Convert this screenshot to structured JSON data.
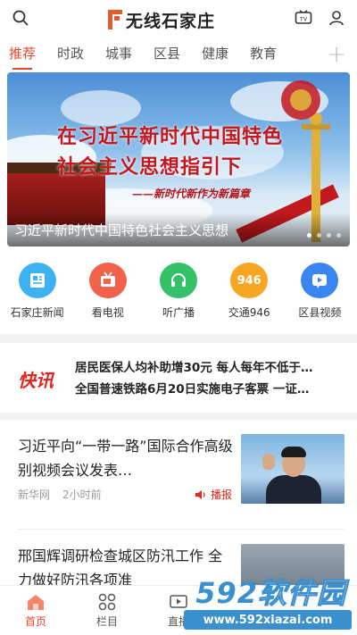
{
  "header": {
    "logo_text": "无线石家庄",
    "accent": "#e25c2c"
  },
  "tabs": {
    "items": [
      {
        "label": "推荐",
        "active": true
      },
      {
        "label": "时政"
      },
      {
        "label": "城事"
      },
      {
        "label": "区县"
      },
      {
        "label": "健康"
      },
      {
        "label": "教育"
      }
    ],
    "add_label": "+"
  },
  "banner": {
    "line1": "在习近平新时代中国特色",
    "line2": "社会主义思想指引下",
    "subtitle": "——新时代新作为新篇章",
    "caption": "习近平新时代中国特色社会主义思想",
    "dots": 4,
    "active_dot": 0
  },
  "quick_links": [
    {
      "label": "石家庄新闻",
      "icon": "newspaper-icon",
      "color": "#3eb2f0"
    },
    {
      "label": "看电视",
      "icon": "tv-icon",
      "color": "#f0624c"
    },
    {
      "label": "听广播",
      "icon": "headphones-icon",
      "color": "#35c06a"
    },
    {
      "label": "交通946",
      "icon": "traffic-946-icon",
      "color": "#f5a623",
      "badge": "946"
    },
    {
      "label": "区县视频",
      "icon": "play-icon",
      "color": "#3a86f0"
    }
  ],
  "flash": {
    "logo": "快讯",
    "items": [
      "居民医保人均补助增30元 每人每年不低于…",
      "全国普速铁路6月20日实施电子客票 一证…"
    ]
  },
  "articles": [
    {
      "title": "习近平向“一带一路”国际合作高级别视频会议发表…",
      "source": "新华网",
      "time": "2小时前",
      "broadcast": "播报"
    },
    {
      "title": "邢国辉调研检查城区防汛工作 全力做好防汛各项准",
      "source": "",
      "time": ""
    }
  ],
  "bottom_nav": [
    {
      "label": "首页",
      "active": true
    },
    {
      "label": "栏目"
    },
    {
      "label": "直播"
    }
  ],
  "watermark": {
    "brand_num": "592",
    "brand_text": "软件园",
    "url": "www.592xiazai.com"
  }
}
